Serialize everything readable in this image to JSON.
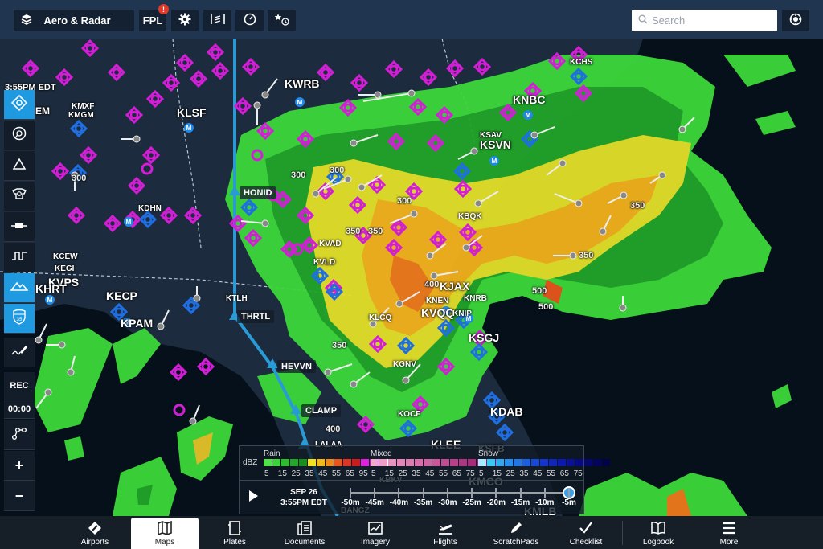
{
  "toolbar": {
    "layers_label": "Aero & Radar",
    "fpl_label": "FPL",
    "fpl_badge": "!",
    "search_placeholder": "Search",
    "icons": [
      "layers-icon",
      "settings-gear-icon",
      "weather-sounding-icon",
      "gauge-icon",
      "favorites-recent-icon",
      "locate-crosshair-icon"
    ]
  },
  "map": {
    "time_label": "3:55PM EDT",
    "airports": [
      {
        "id": "KWRB"
      },
      {
        "id": "KLSF"
      },
      {
        "id": "KMXF"
      },
      {
        "id": "KMGM"
      },
      {
        "id": "KDHN"
      },
      {
        "id": "KCEW"
      },
      {
        "id": "KEGI"
      },
      {
        "id": "KVPS"
      },
      {
        "id": "KHRT"
      },
      {
        "id": "KECP"
      },
      {
        "id": "KPAM"
      },
      {
        "id": "KTLH"
      },
      {
        "id": "KVAD"
      },
      {
        "id": "KVLD"
      },
      {
        "id": "KNBC"
      },
      {
        "id": "KCHS"
      },
      {
        "id": "KSAV"
      },
      {
        "id": "KSVN"
      },
      {
        "id": "KBQK"
      },
      {
        "id": "KJAX"
      },
      {
        "id": "KNEN"
      },
      {
        "id": "KNRB"
      },
      {
        "id": "KVQQ"
      },
      {
        "id": "KNIP"
      },
      {
        "id": "KLCQ"
      },
      {
        "id": "KSGJ"
      },
      {
        "id": "KGNV"
      },
      {
        "id": "KOCF"
      },
      {
        "id": "KDAB"
      },
      {
        "id": "KLEE"
      },
      {
        "id": "KSFB"
      },
      {
        "id": "KBKV"
      },
      {
        "id": "KMCO"
      },
      {
        "id": "KMLB"
      },
      {
        "id": "EM"
      }
    ],
    "route_waypoints": [
      "HONID",
      "THRTL",
      "HEVVN",
      "CLAMP",
      "LALAA",
      "BANGZ"
    ],
    "altitudes": [
      "300",
      "300",
      "300",
      "300",
      "350",
      "350",
      "350",
      "350",
      "350",
      "400",
      "500",
      "500",
      "400"
    ],
    "colors": {
      "route": "#2a9ad6",
      "airport_blue": "#1f6fe0",
      "airport_magenta": "#d21fd6",
      "land": "#1c2b3d",
      "water": "#05101b"
    }
  },
  "left_rail": {
    "buttons": [
      {
        "name": "map-center-button",
        "icon": "crosshair-icon",
        "active": true
      },
      {
        "name": "track-up-button",
        "icon": "compass-icon",
        "active": false
      },
      {
        "name": "obstacles-button",
        "icon": "triangle-icon",
        "active": false
      },
      {
        "name": "traffic-button",
        "icon": "cockpit-icon",
        "active": false
      },
      {
        "name": "runway-button",
        "icon": "runway-icon",
        "active": false
      },
      {
        "name": "profile-button",
        "icon": "profile-icon",
        "active": false
      },
      {
        "name": "terrain-button",
        "icon": "mountain-icon",
        "active": true
      },
      {
        "name": "highway-button",
        "icon": "highway-shield-icon",
        "active": true,
        "shield_text": "35"
      }
    ],
    "draw_icon": "pen-draw-icon",
    "rec_label": "REC",
    "rec_timer": "00:00",
    "route_edit_icon": "route-nodes-icon",
    "zoom_in": "+",
    "zoom_out": "−"
  },
  "legend": {
    "unit": "dBZ",
    "groups": [
      {
        "name": "Rain",
        "ticks": [
          "5",
          "15",
          "25",
          "35",
          "45",
          "55",
          "65",
          "95"
        ],
        "colors": [
          "#4fe04a",
          "#3cd23a",
          "#2dbd2f",
          "#20a826",
          "#178f1f",
          "#f2e21c",
          "#f2b81a",
          "#ee8a18",
          "#e8561e",
          "#df3324",
          "#c81e1e",
          "#e21ee0",
          "#b01ad0",
          "#8a2ad4",
          "#ffffff"
        ]
      },
      {
        "name": "Mixed",
        "ticks": [
          "5",
          "15",
          "25",
          "35",
          "45",
          "55",
          "65",
          "75"
        ],
        "colors": [
          "#f2a8cc",
          "#ef9ec6",
          "#ea92bf",
          "#e487b8",
          "#de7cb1",
          "#d770aa",
          "#d064a2",
          "#c8589a",
          "#c04c92",
          "#b8418a",
          "#b03682",
          "#a82c7a",
          "#9e2270",
          "#951a68",
          "#8c1260"
        ]
      },
      {
        "name": "Snow",
        "ticks": [
          "5",
          "15",
          "25",
          "35",
          "45",
          "55",
          "65",
          "75"
        ],
        "colors": [
          "#a8ecff",
          "#3cc8f4",
          "#30aaf0",
          "#2890ec",
          "#2078e6",
          "#1c60e0",
          "#1848d8",
          "#1434cc",
          "#1024c0",
          "#0c18ae",
          "#0a1098",
          "#080a84",
          "#060670",
          "#04045c",
          "#020248"
        ]
      }
    ]
  },
  "timeline": {
    "date": "SEP 26",
    "time": "3:55PM EDT",
    "labels": [
      "-50m",
      "-45m",
      "-40m",
      "-35m",
      "-30m",
      "-25m",
      "-20m",
      "-15m",
      "-10m",
      "-5m"
    ],
    "position_fraction": 1.0,
    "play_icon": "play-icon"
  },
  "tabs": [
    {
      "label": "Airports",
      "icon": "airports-icon",
      "active": false
    },
    {
      "label": "Maps",
      "icon": "maps-icon",
      "active": true
    },
    {
      "label": "Plates",
      "icon": "plates-icon",
      "active": false
    },
    {
      "label": "Documents",
      "icon": "documents-icon",
      "active": false
    },
    {
      "label": "Imagery",
      "icon": "imagery-icon",
      "active": false
    },
    {
      "label": "Flights",
      "icon": "flights-icon",
      "active": false
    },
    {
      "label": "ScratchPads",
      "icon": "scratchpads-icon",
      "active": false
    },
    {
      "label": "Checklist",
      "icon": "checklist-icon",
      "active": false
    },
    {
      "label": "Logbook",
      "icon": "logbook-icon",
      "active": false
    },
    {
      "label": "More",
      "icon": "more-icon",
      "active": false
    }
  ]
}
